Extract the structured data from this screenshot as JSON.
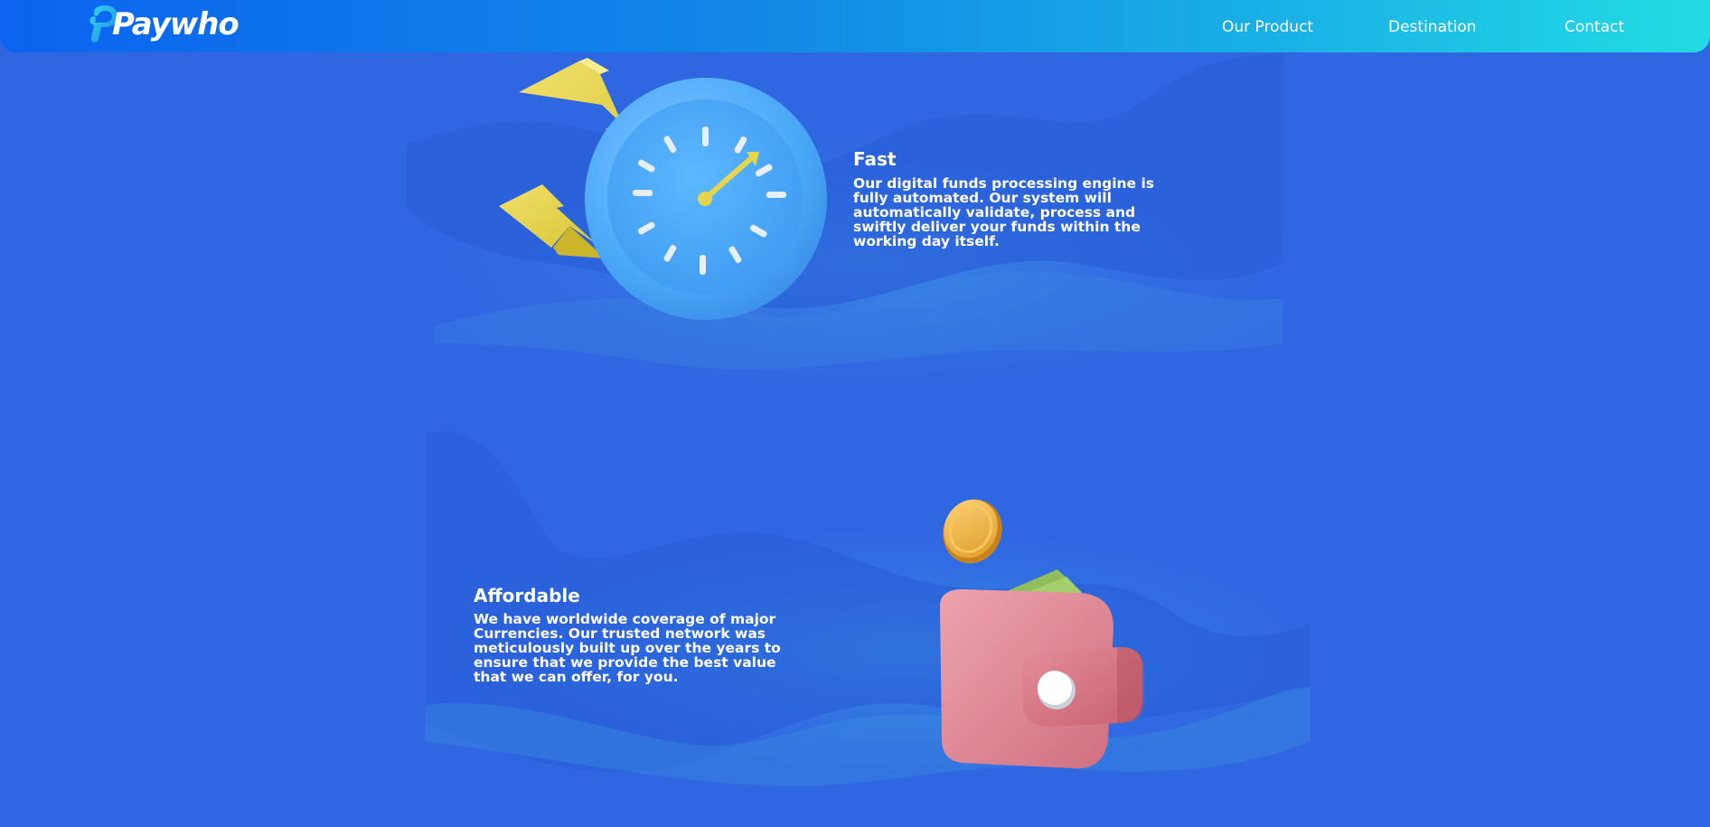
{
  "brand": {
    "name": "Paywho"
  },
  "nav": {
    "items": [
      {
        "label": "Our Product"
      },
      {
        "label": "Destination"
      },
      {
        "label": "Contact"
      }
    ]
  },
  "features": [
    {
      "title": "Fast",
      "description": "Our digital funds processing engine is fully automated. Our system will automatically validate, process and swiftly deliver your funds within the working day itself.",
      "illustration": "clock-with-lightning-icon"
    },
    {
      "title": "Affordable",
      "description": "We have worldwide coverage of major Currencies. Our trusted network was meticulously built up over the years to ensure that we provide the best value that we can offer, for you.",
      "illustration": "wallet-with-coin-icon"
    }
  ],
  "colors": {
    "background": "#2f66e2",
    "nav_gradient_start": "#0b63ef",
    "nav_gradient_end": "#22dce4",
    "accent_yellow": "#e6d44a",
    "clock_blue": "#4fb0fb",
    "wallet_pink": "#dc8393",
    "coin_gold": "#f4b640"
  }
}
